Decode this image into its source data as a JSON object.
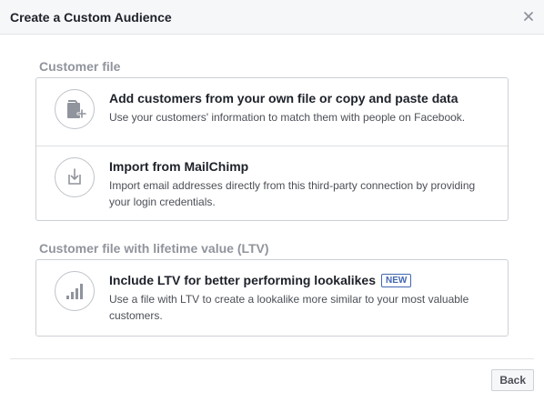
{
  "header": {
    "title": "Create a Custom Audience",
    "close_icon": "close-icon"
  },
  "sections": [
    {
      "label": "Customer file",
      "options": [
        {
          "icon": "file-add-icon",
          "title": "Add customers from your own file or copy and paste data",
          "description": "Use your customers' information to match them with people on Facebook."
        },
        {
          "icon": "import-icon",
          "title": "Import from MailChimp",
          "description": "Import email addresses directly from this third-party connection by providing your login credentials."
        }
      ]
    },
    {
      "label": "Customer file with lifetime value (LTV)",
      "options": [
        {
          "icon": "bar-chart-icon",
          "title": "Include LTV for better performing lookalikes",
          "badge": "NEW",
          "description": "Use a file with LTV to create a lookalike more similar to your most valuable customers."
        }
      ]
    }
  ],
  "footer": {
    "back_label": "Back"
  },
  "colors": {
    "header_bg": "#f6f7f9",
    "section_label": "#90949c",
    "border": "#ccd0d5",
    "icon_stroke": "#90949c",
    "badge": "#4267b2"
  }
}
